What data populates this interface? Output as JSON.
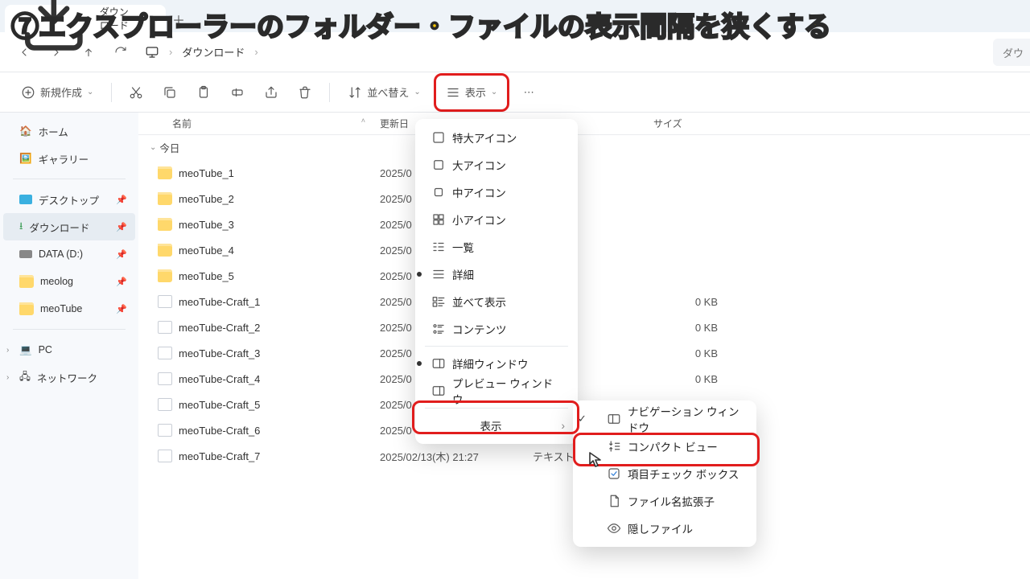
{
  "overlay_title": "⑦エクスプローラーのフォルダー・ファイルの表示間隔を狭くする",
  "tab": {
    "title": "ダウンロード"
  },
  "breadcrumb": {
    "item": "ダウンロード"
  },
  "search_placeholder": "ダウ",
  "toolbar": {
    "new_label": "新規作成",
    "sort_label": "並べ替え",
    "view_label": "表示"
  },
  "columns": {
    "name": "名前",
    "date": "更新日",
    "type": "",
    "size": "サイズ"
  },
  "group": {
    "today": "今日"
  },
  "sidebar": {
    "home": "ホーム",
    "gallery": "ギャラリー",
    "desktop": "デスクトップ",
    "downloads": "ダウンロード",
    "data": "DATA (D:)",
    "meolog": "meolog",
    "meoTube": "meoTube",
    "pc": "PC",
    "network": "ネットワーク"
  },
  "files": [
    {
      "name": "meoTube_1",
      "date": "2025/0",
      "type": "",
      "size": "",
      "kind": "folder"
    },
    {
      "name": "meoTube_2",
      "date": "2025/0",
      "type": "",
      "size": "",
      "kind": "folder"
    },
    {
      "name": "meoTube_3",
      "date": "2025/0",
      "type": "",
      "size": "",
      "kind": "folder"
    },
    {
      "name": "meoTube_4",
      "date": "2025/0",
      "type": "",
      "size": "",
      "kind": "folder"
    },
    {
      "name": "meoTube_5",
      "date": "2025/0",
      "type": "",
      "size": "",
      "kind": "folder"
    },
    {
      "name": "meoTube-Craft_1",
      "date": "2025/0",
      "type": "ト",
      "size": "0 KB",
      "kind": "doc"
    },
    {
      "name": "meoTube-Craft_2",
      "date": "2025/0",
      "type": "ト",
      "size": "0 KB",
      "kind": "doc"
    },
    {
      "name": "meoTube-Craft_3",
      "date": "2025/0",
      "type": "ト",
      "size": "0 KB",
      "kind": "doc"
    },
    {
      "name": "meoTube-Craft_4",
      "date": "2025/0",
      "type": "ト",
      "size": "0 KB",
      "kind": "doc"
    },
    {
      "name": "meoTube-Craft_5",
      "date": "2025/0",
      "type": "",
      "size": "",
      "kind": "doc"
    },
    {
      "name": "meoTube-Craft_6",
      "date": "2025/0",
      "type": "",
      "size": "",
      "kind": "doc"
    },
    {
      "name": "meoTube-Craft_7",
      "date": "2025/02/13(木) 21:27",
      "type": "テキスト ドキュメ",
      "size": "",
      "kind": "doc"
    }
  ],
  "menu_view": {
    "xl": "特大アイコン",
    "lg": "大アイコン",
    "md": "中アイコン",
    "sm": "小アイコン",
    "list": "一覧",
    "details": "詳細",
    "tiles": "並べて表示",
    "content": "コンテンツ",
    "details_pane": "詳細ウィンドウ",
    "preview_pane": "プレビュー ウィンドウ",
    "show": "表示"
  },
  "submenu_show": {
    "nav_pane": "ナビゲーション ウィンドウ",
    "compact": "コンパクト ビュー",
    "checkboxes": "項目チェック ボックス",
    "extensions": "ファイル名拡張子",
    "hidden": "隠しファイル"
  }
}
